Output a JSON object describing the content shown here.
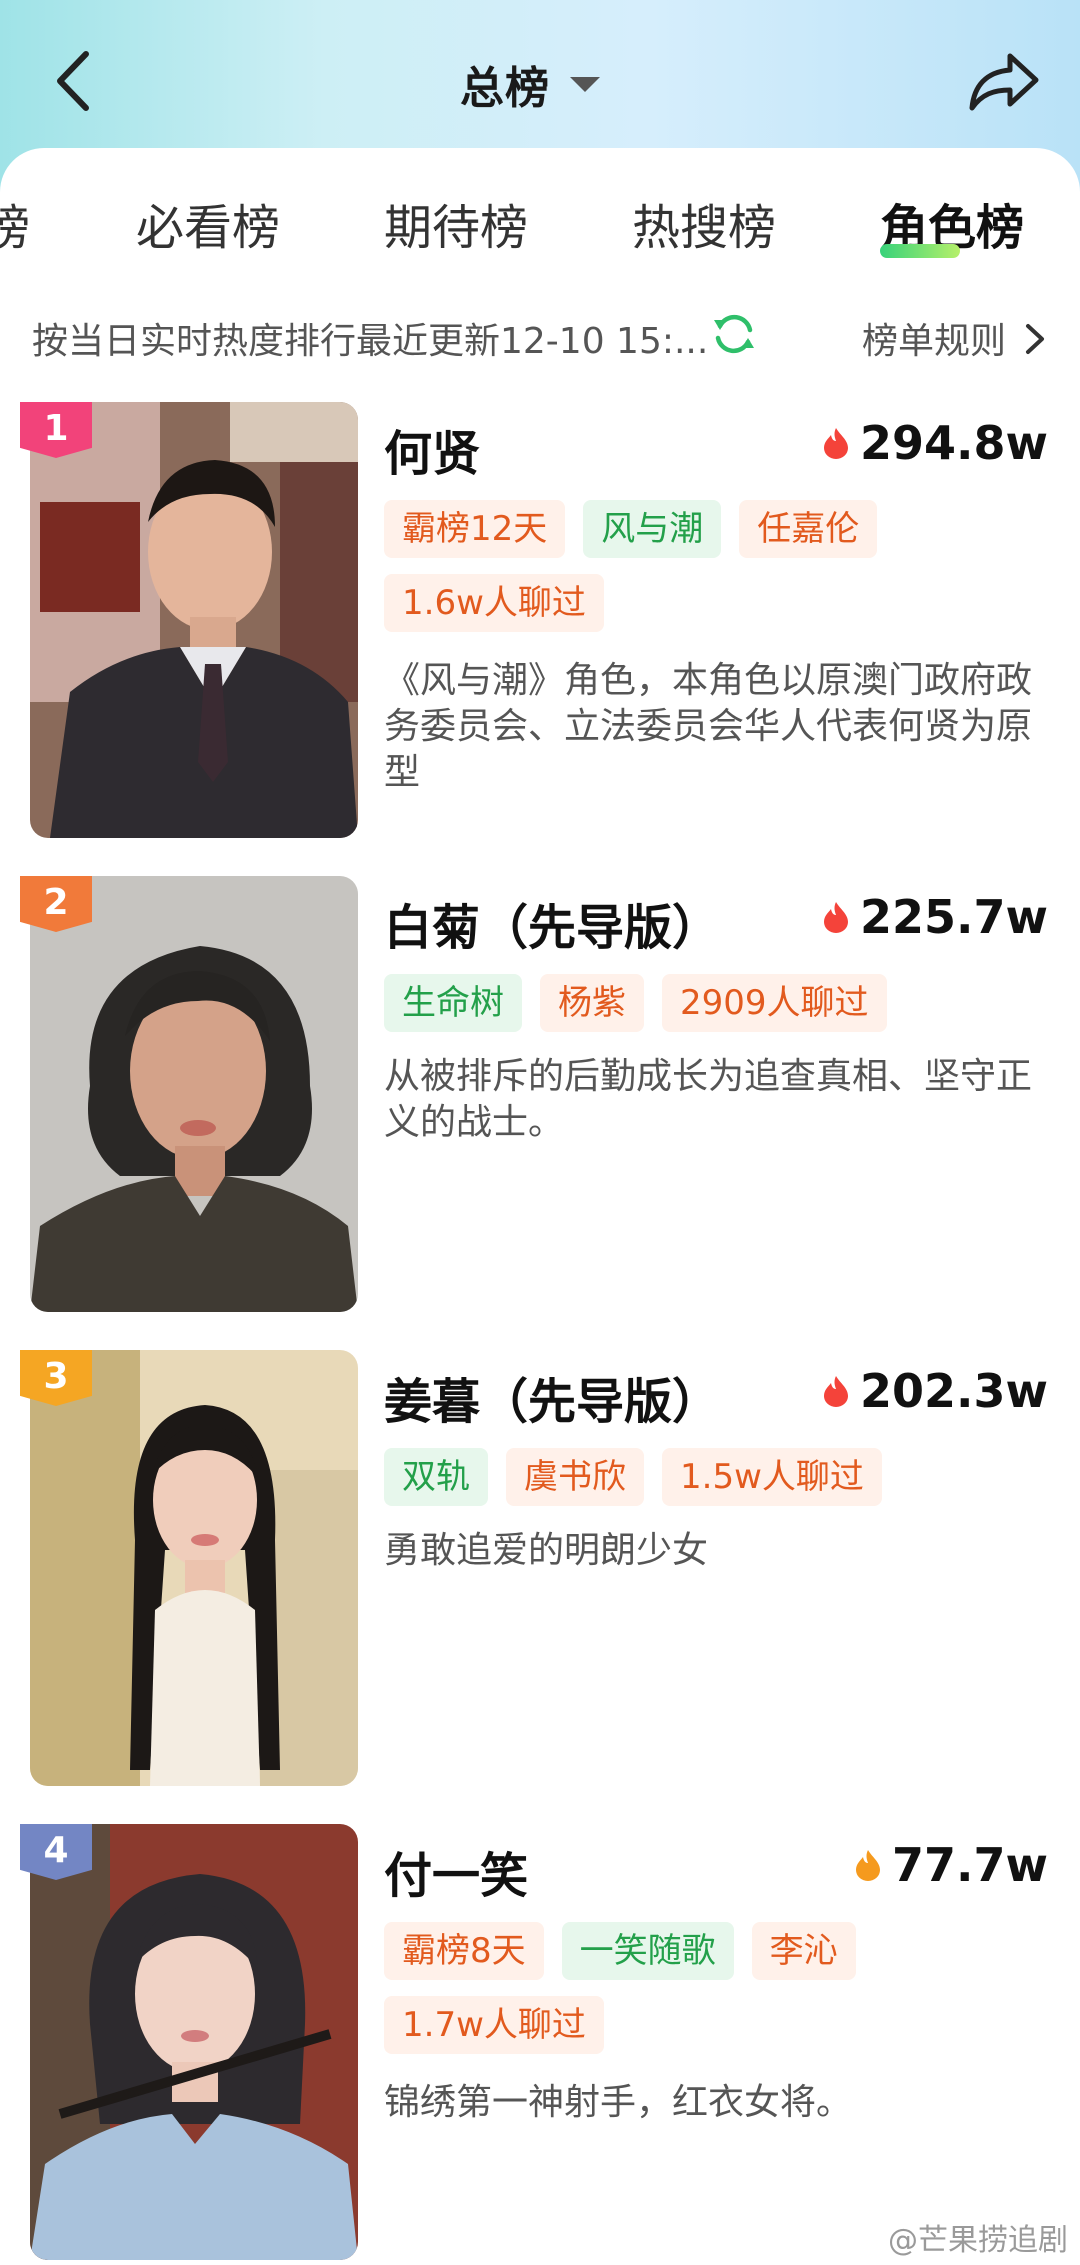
{
  "header": {
    "title": "总榜"
  },
  "tabs": [
    {
      "label": "榜"
    },
    {
      "label": "必看榜"
    },
    {
      "label": "期待榜"
    },
    {
      "label": "热搜榜"
    },
    {
      "label": "角色榜",
      "active": true
    }
  ],
  "info": {
    "text": "按当日实时热度排行最近更新12-10 15:...",
    "rules_label": "榜单规则"
  },
  "colors": {
    "rank_1": "#f2437a",
    "rank_2": "#f17a3a",
    "rank_3": "#f5a623",
    "rank_4": "#7386c4",
    "accent_green": "#37d27a"
  },
  "ranking": [
    {
      "rank": "1",
      "name": "何贤",
      "heat": "294.8w",
      "tags": [
        {
          "text": "霸榜12天",
          "style": "orange"
        },
        {
          "text": "风与潮",
          "style": "green"
        },
        {
          "text": "任嘉伦",
          "style": "orange"
        },
        {
          "text": "1.6w人聊过",
          "style": "orange"
        }
      ],
      "desc": "《风与潮》角色，本角色以原澳门政府政务委员会、立法委员会华人代表何贤为原型"
    },
    {
      "rank": "2",
      "name": "白菊（先导版）",
      "heat": "225.7w",
      "tags": [
        {
          "text": "生命树",
          "style": "green"
        },
        {
          "text": "杨紫",
          "style": "orange"
        },
        {
          "text": "2909人聊过",
          "style": "orange"
        }
      ],
      "desc": "从被排斥的后勤成长为追查真相、坚守正义的战士。"
    },
    {
      "rank": "3",
      "name": "姜暮（先导版）",
      "heat": "202.3w",
      "tags": [
        {
          "text": "双轨",
          "style": "green"
        },
        {
          "text": "虞书欣",
          "style": "orange"
        },
        {
          "text": "1.5w人聊过",
          "style": "orange"
        }
      ],
      "desc": "勇敢追爱的明朗少女"
    },
    {
      "rank": "4",
      "name": "付一笑",
      "heat": "77.7w",
      "tags": [
        {
          "text": "霸榜8天",
          "style": "orange"
        },
        {
          "text": "一笑随歌",
          "style": "green"
        },
        {
          "text": "李沁",
          "style": "orange"
        },
        {
          "text": "1.7w人聊过",
          "style": "orange"
        }
      ],
      "desc": "锦绣第一神射手，红衣女将。"
    }
  ],
  "watermark": "@芒果捞追剧"
}
